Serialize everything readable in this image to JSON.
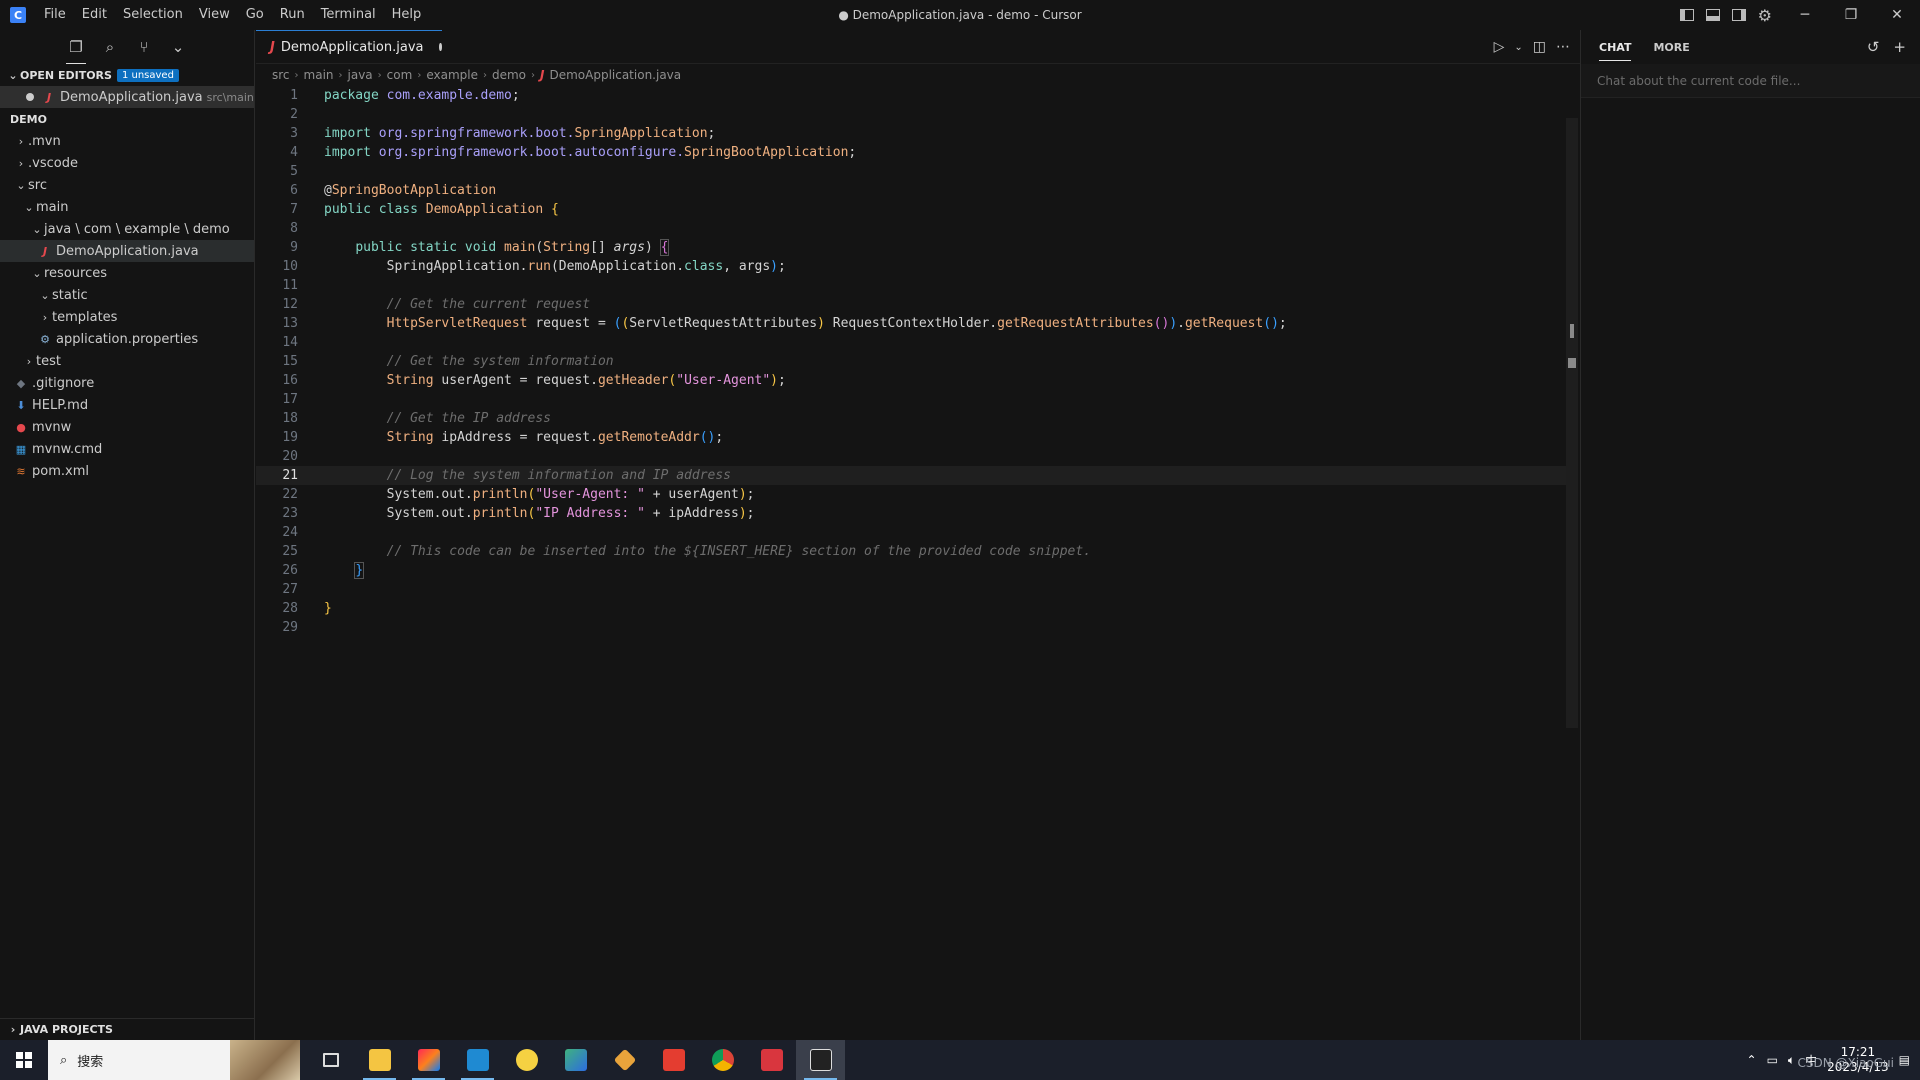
{
  "window": {
    "title": "● DemoApplication.java - demo - Cursor",
    "menu": [
      "File",
      "Edit",
      "Selection",
      "View",
      "Go",
      "Run",
      "Terminal",
      "Help"
    ]
  },
  "sidebar": {
    "open_editors_label": "OPEN EDITORS",
    "unsaved_badge": "1 unsaved",
    "open_editor": {
      "name": "DemoApplication.java",
      "path": "src\\main\\..."
    },
    "project_label": "DEMO",
    "tree": [
      {
        "label": ".mvn",
        "depth": 0,
        "type": "folder",
        "open": false
      },
      {
        "label": ".vscode",
        "depth": 0,
        "type": "folder",
        "open": false
      },
      {
        "label": "src",
        "depth": 0,
        "type": "folder",
        "open": true
      },
      {
        "label": "main",
        "depth": 1,
        "type": "folder",
        "open": true
      },
      {
        "label": "java \\ com \\ example \\ demo",
        "depth": 2,
        "type": "folder",
        "open": true
      },
      {
        "label": "DemoApplication.java",
        "depth": 3,
        "type": "java",
        "selected": true
      },
      {
        "label": "resources",
        "depth": 2,
        "type": "folder",
        "open": true
      },
      {
        "label": "static",
        "depth": 3,
        "type": "folder",
        "open": true
      },
      {
        "label": "templates",
        "depth": 3,
        "type": "folder",
        "open": false
      },
      {
        "label": "application.properties",
        "depth": 3,
        "type": "gear"
      },
      {
        "label": "test",
        "depth": 1,
        "type": "folder",
        "open": false
      },
      {
        "label": ".gitignore",
        "depth": 0,
        "type": "git"
      },
      {
        "label": "HELP.md",
        "depth": 0,
        "type": "md"
      },
      {
        "label": "mvnw",
        "depth": 0,
        "type": "mvn"
      },
      {
        "label": "mvnw.cmd",
        "depth": 0,
        "type": "cmd"
      },
      {
        "label": "pom.xml",
        "depth": 0,
        "type": "xml"
      }
    ],
    "bottom_section": "JAVA PROJECTS"
  },
  "editor": {
    "tab_label": "DemoApplication.java",
    "breadcrumb": [
      "src",
      "main",
      "java",
      "com",
      "example",
      "demo",
      "DemoApplication.java"
    ],
    "current_line": 21
  },
  "chat": {
    "tabs": [
      "CHAT",
      "MORE"
    ],
    "placeholder": "Chat about the current code file..."
  },
  "taskbar": {
    "search_label": "搜索",
    "clock_time": "17:21",
    "clock_date": "2023/4/13",
    "ime": "中",
    "watermark": "CSDN @XiaoGui"
  },
  "colors": {
    "accent": "#0e70c0",
    "keyword": "#83d6c5",
    "type": "#efb080",
    "string": "#e394dc",
    "comment": "#6d6d6d"
  }
}
